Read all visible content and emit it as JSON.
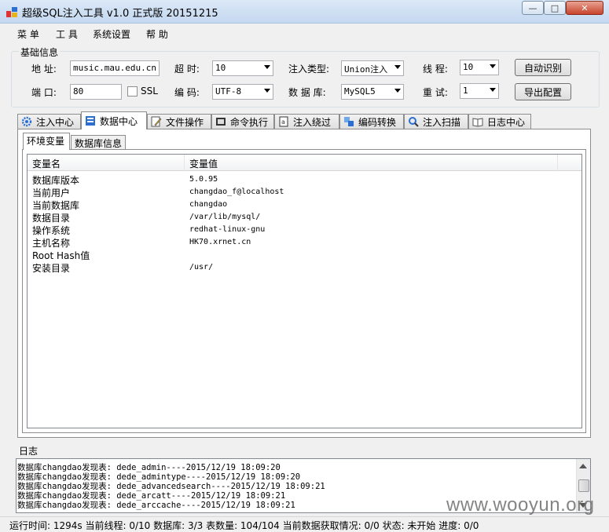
{
  "window": {
    "title": "超级SQL注入工具 v1.0 正式版 20151215",
    "min_glyph": "—",
    "max_glyph": "□",
    "close_glyph": "✕"
  },
  "menu": [
    "菜 单",
    "工 具",
    "系统设置",
    "帮 助"
  ],
  "basic": {
    "group_title": "基础信息",
    "address_label": "地 址:",
    "address_value": "music.mau.edu.cn",
    "port_label": "端 口:",
    "port_value": "80",
    "ssl_label": "SSL",
    "timeout_label": "超 时:",
    "timeout_value": "10",
    "encoding_label": "编 码:",
    "encoding_value": "UTF-8",
    "inject_type_label": "注入类型:",
    "inject_type_value": "Union注入",
    "db_label": "数 据 库:",
    "db_value": "MySQL5",
    "threads_label": "线 程:",
    "threads_value": "10",
    "retry_label": "重 试:",
    "retry_value": "1",
    "auto_detect_button": "自动识别",
    "export_config_button": "导出配置"
  },
  "tabs": [
    "注入中心",
    "数据中心",
    "文件操作",
    "命令执行",
    "注入绕过",
    "编码转换",
    "注入扫描",
    "日志中心"
  ],
  "subtabs": [
    "环境变量",
    "数据库信息"
  ],
  "table": {
    "columns": [
      "变量名",
      "变量值"
    ],
    "rows": [
      [
        "数据库版本",
        "5.0.95"
      ],
      [
        "当前用户",
        "changdao_f@localhost"
      ],
      [
        "当前数据库",
        "changdao"
      ],
      [
        "数据目录",
        "/var/lib/mysql/"
      ],
      [
        "操作系统",
        "redhat-linux-gnu"
      ],
      [
        "主机名称",
        "HK70.xrnet.cn"
      ],
      [
        "Root Hash值",
        ""
      ],
      [
        "安装目录",
        "/usr/"
      ]
    ]
  },
  "log": {
    "title": "日志",
    "lines": [
      "数据库changdao发现表: dede_admin----2015/12/19 18:09:20",
      "数据库changdao发现表: dede_admintype----2015/12/19 18:09:20",
      "数据库changdao发现表: dede_advancedsearch----2015/12/19 18:09:21",
      "数据库changdao发现表: dede_arcatt----2015/12/19 18:09:21",
      "数据库changdao发现表: dede_arccache----2015/12/19 18:09:21"
    ]
  },
  "status": "运行时间: 1294s 当前线程: 0/10 数据库: 3/3 表数量: 104/104 当前数据获取情况: 0/0 状态: 未开始 进度: 0/0",
  "watermark": "www.wooyun.org",
  "colors": {
    "titlebar_top": "#dbe8f7",
    "close_button": "#c8442b",
    "panel_bg": "#f0f0f0"
  }
}
